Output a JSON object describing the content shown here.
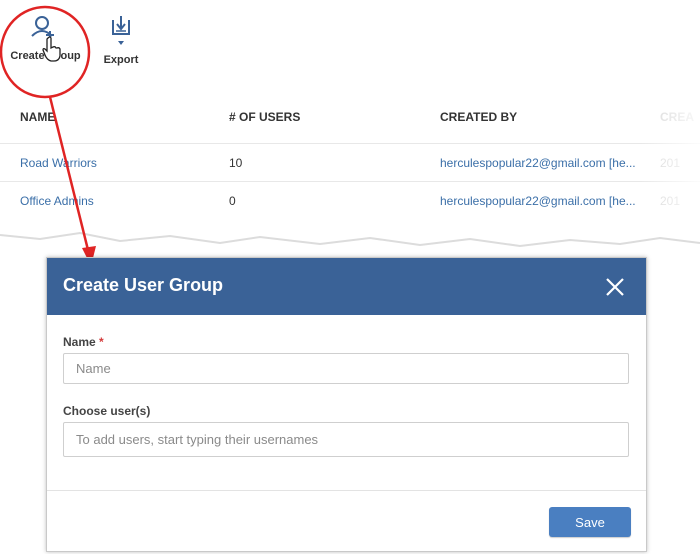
{
  "toolbar": {
    "create_group_label": "Create Group",
    "export_label": "Export"
  },
  "table": {
    "headers": [
      "NAME",
      "# OF USERS",
      "CREATED BY",
      "CREA"
    ],
    "rows": [
      {
        "name": "Road Warriors",
        "users": "10",
        "created_by": "herculespopular22@gmail.com [he...",
        "created": "201"
      },
      {
        "name": "Office Admins",
        "users": "0",
        "created_by": "herculespopular22@gmail.com [he...",
        "created": "201"
      }
    ]
  },
  "modal": {
    "title": "Create User Group",
    "name_label": "Name",
    "required_mark": "*",
    "name_placeholder": "Name",
    "users_label": "Choose user(s)",
    "users_placeholder": "To add users, start typing their usernames",
    "save_label": "Save"
  },
  "colors": {
    "header_bg": "#3a6297",
    "save_bg": "#4a7fc1",
    "link": "#3b6fa8",
    "annotation": "#e02424"
  },
  "icons": {
    "create_group": "add-user-icon",
    "pointer": "hand-pointer-icon",
    "export": "export-download-icon",
    "close": "close-icon"
  }
}
